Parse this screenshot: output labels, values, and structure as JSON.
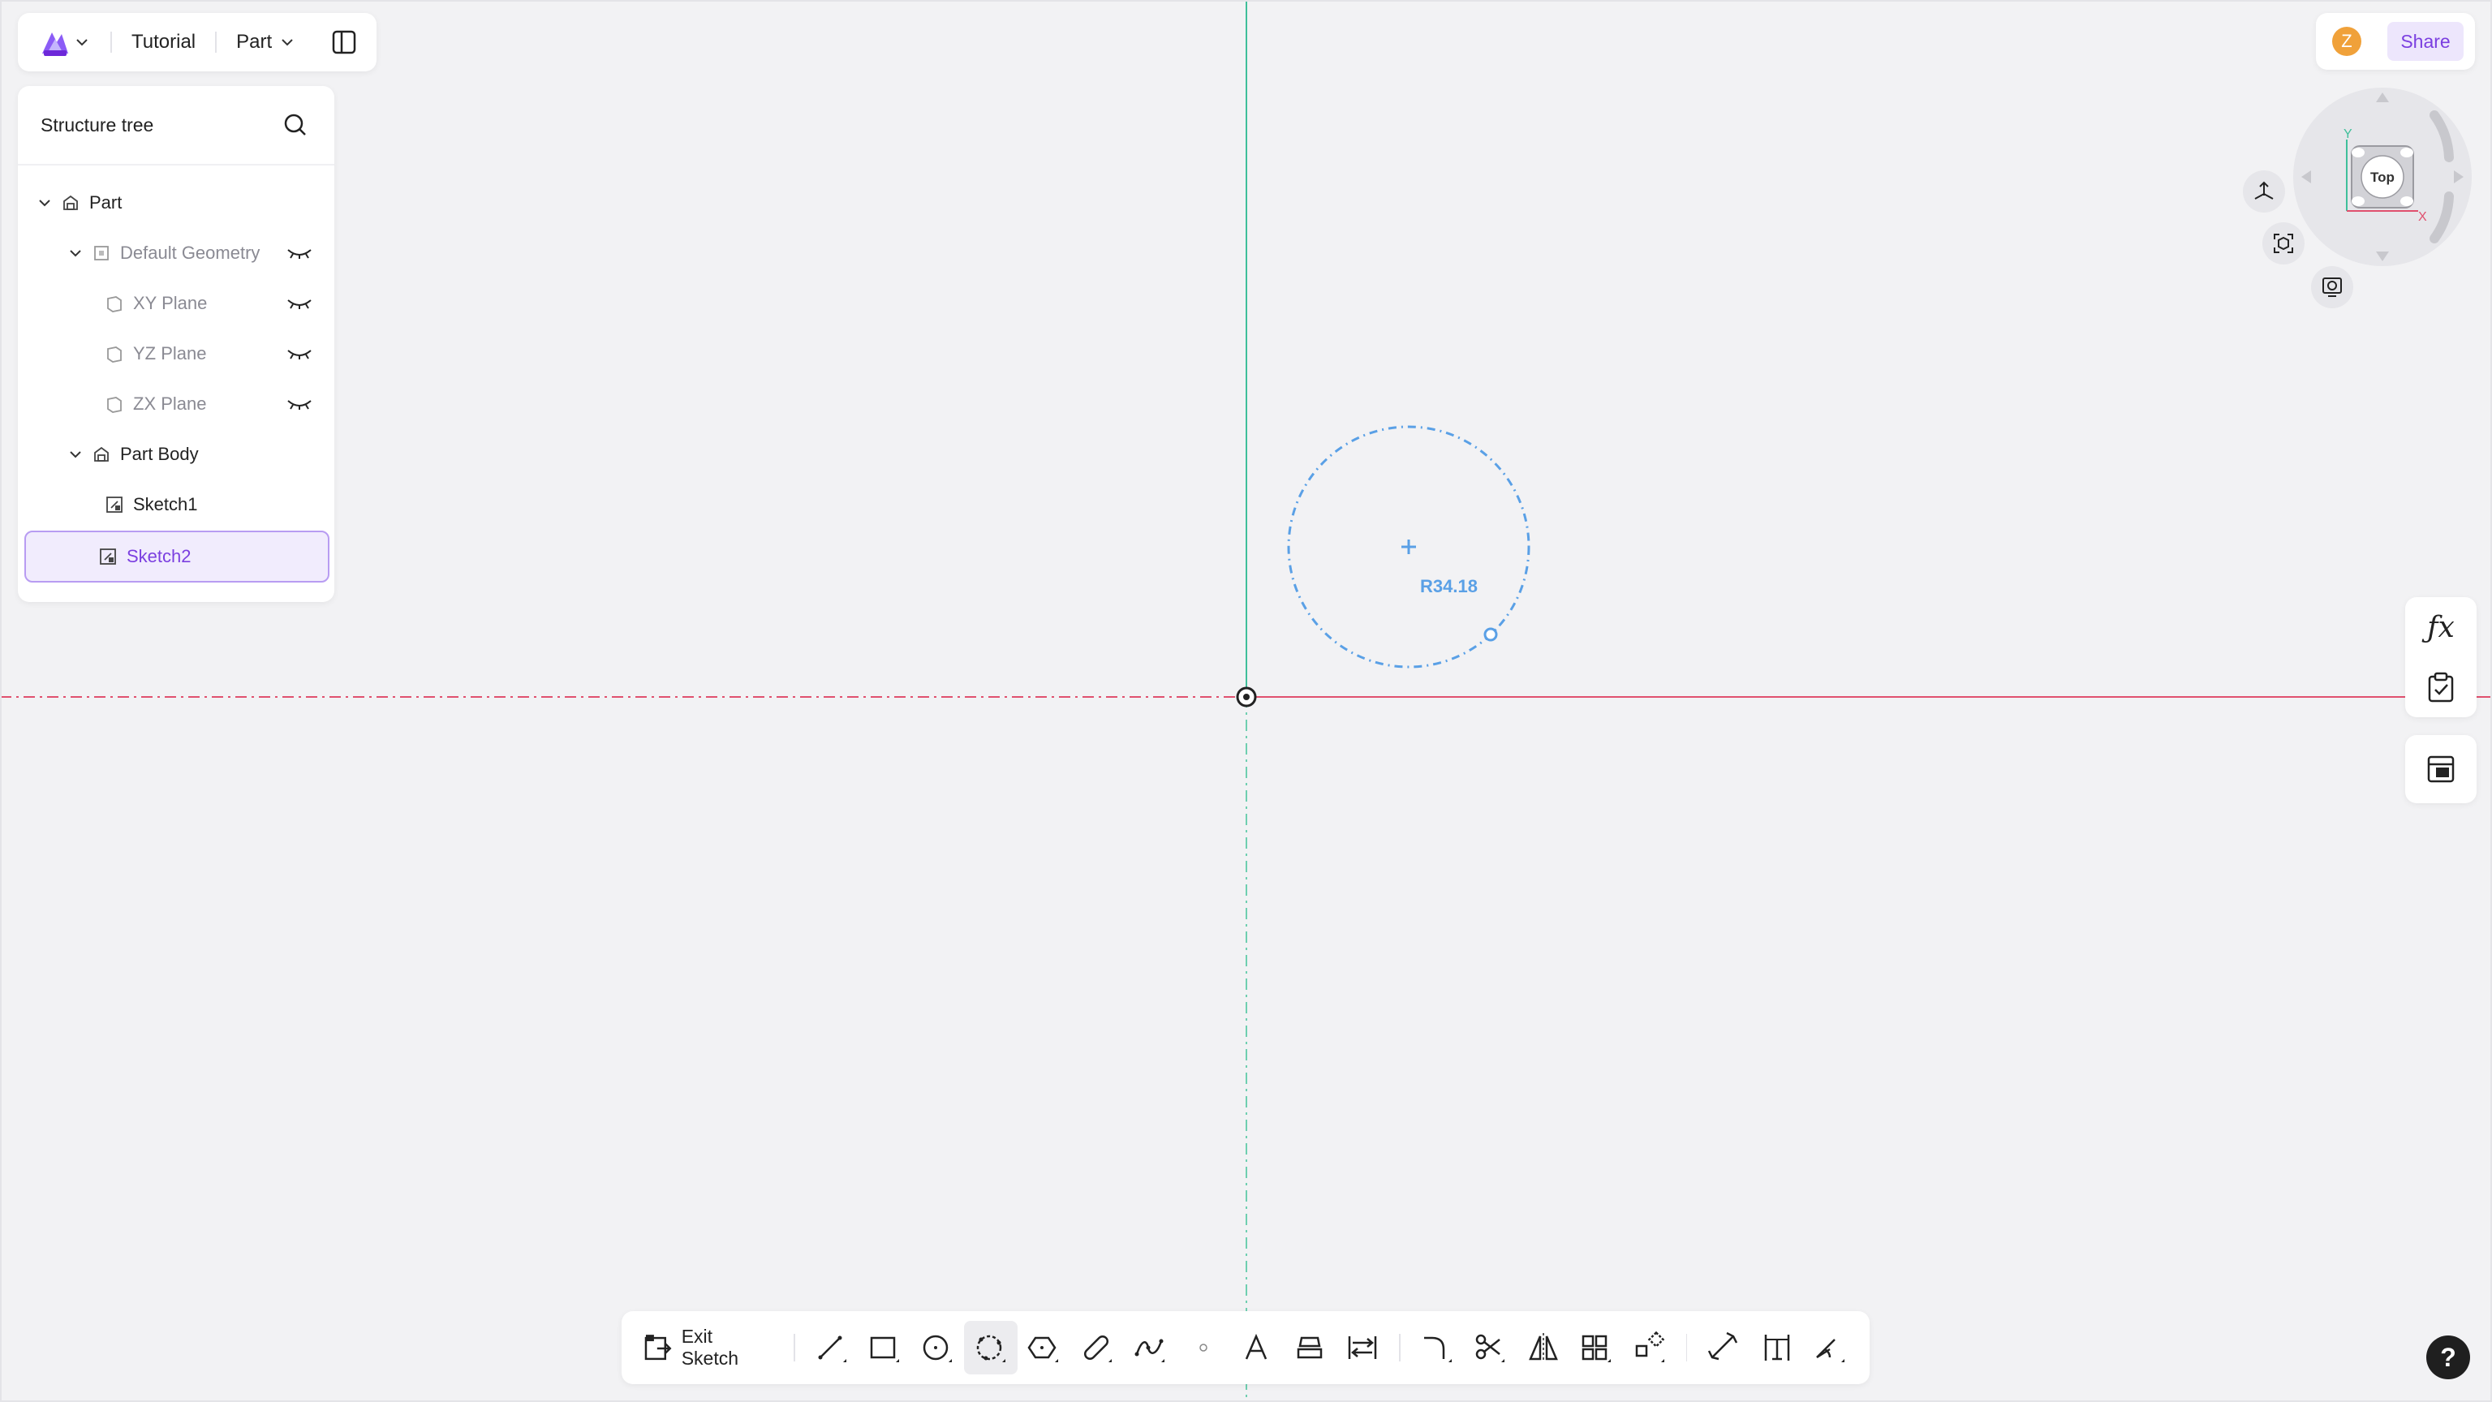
{
  "topbar": {
    "project": "Tutorial",
    "mode": "Part"
  },
  "tree": {
    "title": "Structure tree",
    "items": [
      {
        "label": "Part"
      },
      {
        "label": "Default Geometry"
      },
      {
        "label": "XY Plane"
      },
      {
        "label": "YZ Plane"
      },
      {
        "label": "ZX Plane"
      },
      {
        "label": "Part Body"
      },
      {
        "label": "Sketch1"
      },
      {
        "label": "Sketch2"
      }
    ]
  },
  "user": {
    "initial": "Z"
  },
  "share": {
    "label": "Share"
  },
  "viewcube": {
    "face": "Top",
    "axis_x": "X",
    "axis_y": "Y"
  },
  "sketch": {
    "dimension": "R34.18"
  },
  "toolbar": {
    "exit_label": "Exit Sketch"
  },
  "help": {
    "label": "?"
  },
  "colors": {
    "accent": "#7b3fe0",
    "x_axis": "#e0506e",
    "y_axis": "#3fbf9a",
    "sketch_preview": "#5aa0e6"
  }
}
